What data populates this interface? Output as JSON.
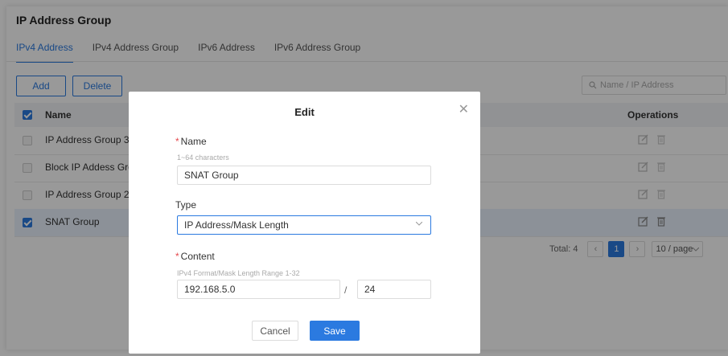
{
  "page": {
    "title": "IP Address Group"
  },
  "tabs": [
    {
      "label": "IPv4 Address",
      "active": true
    },
    {
      "label": "IPv4 Address Group",
      "active": false
    },
    {
      "label": "IPv6 Address",
      "active": false
    },
    {
      "label": "IPv6 Address Group",
      "active": false
    }
  ],
  "toolbar": {
    "add_label": "Add",
    "delete_label": "Delete",
    "search_placeholder": "Name / IP Address"
  },
  "table": {
    "headers": {
      "name": "Name",
      "operations": "Operations"
    },
    "rows": [
      {
        "name": "IP Address Group 3",
        "selected": false
      },
      {
        "name": "Block IP Addess Gro...",
        "selected": false
      },
      {
        "name": "IP Address Group 2",
        "selected": false
      },
      {
        "name": "SNAT Group",
        "selected": true
      }
    ]
  },
  "pagination": {
    "total": "Total: 4",
    "current_page": "1",
    "page_size": "10 / page"
  },
  "modal": {
    "title": "Edit",
    "name_label": "Name",
    "name_hint": "1~64 characters",
    "name_value": "SNAT Group",
    "type_label": "Type",
    "type_value": "IP Address/Mask Length",
    "content_label": "Content",
    "content_hint": "IPv4 Format/Mask Length Range 1-32",
    "ip_value": "192.168.5.0",
    "separator": "/",
    "mask_value": "24",
    "cancel_label": "Cancel",
    "save_label": "Save"
  },
  "colors": {
    "accent": "#2b7ae0",
    "required": "#e5484d",
    "overlay": "rgba(0,0,0,0.40)"
  }
}
